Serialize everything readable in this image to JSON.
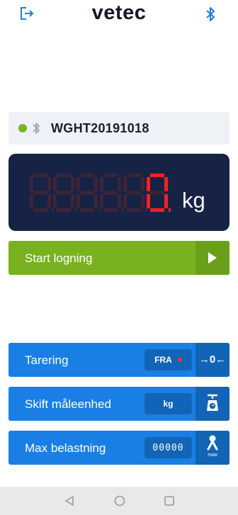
{
  "app": {
    "brand": "vetec"
  },
  "header": {
    "logout_icon": "logout-icon",
    "bluetooth_icon": "bluetooth-icon"
  },
  "device": {
    "status_color": "#78b51f",
    "name": "WGHT20191018"
  },
  "scale": {
    "digits": [
      "8",
      "8",
      "8",
      "8",
      "8",
      "0"
    ],
    "unit": "kg"
  },
  "start_logging": {
    "label": "Start logning"
  },
  "buttons": {
    "tare": {
      "label": "Tarering",
      "value": "FRA",
      "icon_text": "→0←"
    },
    "unit": {
      "label": "Skift måleenhed",
      "value": "kg"
    },
    "max_load": {
      "label": "Max belastning",
      "value": "00000",
      "icon_caption": "max"
    }
  },
  "colors": {
    "green": "#79b220",
    "blue": "#1a7fe4",
    "dark_blue": "#162344",
    "segment_on": "#ff1e1e",
    "segment_off": "#3d2438"
  }
}
